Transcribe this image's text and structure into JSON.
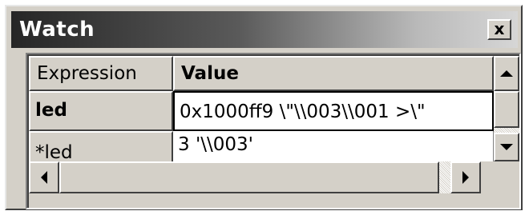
{
  "window": {
    "title": "Watch",
    "close_label": "x"
  },
  "grid": {
    "columns": [
      "Expression",
      "Value"
    ],
    "rows": [
      {
        "expression": "led",
        "value": "0x1000ff9 \\\"\\\\003\\\\001 >\\\"",
        "selected": true
      },
      {
        "expression": "*led",
        "value": "3 '\\\\003'",
        "selected": false
      }
    ]
  },
  "icons": {
    "close": "close-icon",
    "scroll_up": "arrow-up-icon",
    "scroll_down": "arrow-down-icon",
    "scroll_left": "arrow-left-icon",
    "scroll_right": "arrow-right-icon"
  },
  "colors": {
    "face": "#d4d0c8",
    "title_start": "#262626",
    "title_end": "#d6d6d6",
    "cell_bg": "#ffffff"
  }
}
